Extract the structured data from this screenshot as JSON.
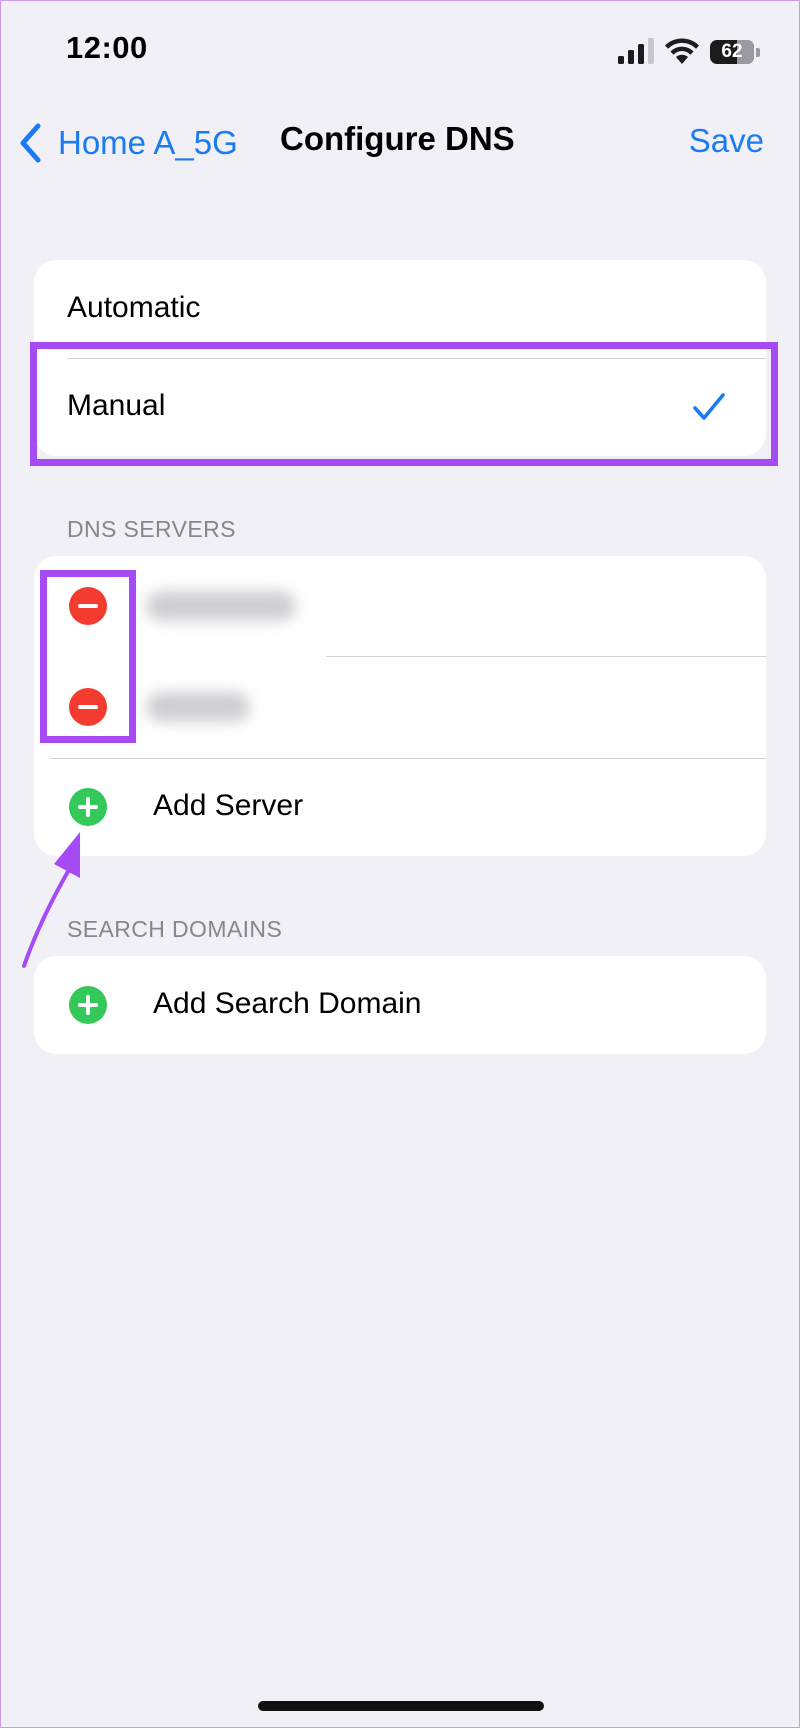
{
  "status_bar": {
    "time": "12:00",
    "battery": "62",
    "battery_level": 0.62,
    "icons": [
      "cellular-signal-icon",
      "wifi-icon",
      "battery-icon"
    ]
  },
  "nav": {
    "back_label": "Home A_5G",
    "title": "Configure DNS",
    "save_label": "Save"
  },
  "mode_options": [
    {
      "label": "Automatic",
      "selected": false
    },
    {
      "label": "Manual",
      "selected": true
    }
  ],
  "dns_servers": {
    "header": "DNS SERVERS",
    "servers_blurred": 2,
    "add_label": "Add Server"
  },
  "search_domains": {
    "header": "SEARCH DOMAINS",
    "add_label": "Add Search Domain"
  },
  "colors": {
    "accent": "#1a7cf0",
    "delete": "#f43b30",
    "add": "#34c759",
    "annotation": "#a64af4",
    "background": "#f1f0f6"
  }
}
